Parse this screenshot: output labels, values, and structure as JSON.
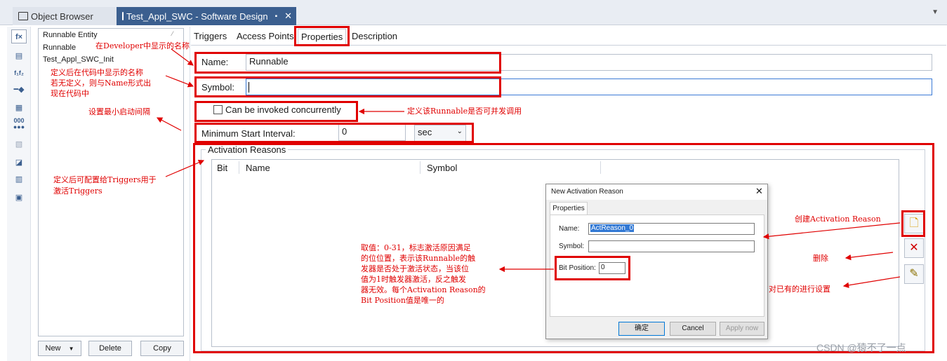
{
  "document_tabs": {
    "object_browser": "Object Browser",
    "software_design": "Test_Appl_SWC - Software Design"
  },
  "runnable_list": {
    "header": "Runnable Entity",
    "items": [
      "Runnable",
      "Test_Appl_SWC_Init"
    ],
    "new_button": "New",
    "delete_button": "Delete",
    "copy_button": "Copy"
  },
  "property_tabs": [
    "Triggers",
    "Access Points",
    "Properties",
    "Description"
  ],
  "properties": {
    "name_label": "Name:",
    "name_value": "Runnable",
    "symbol_label": "Symbol:",
    "symbol_value": "",
    "concurrent_label": "Can be invoked concurrently",
    "concurrent_checked": false,
    "min_interval_label": "Minimum Start Interval:",
    "min_interval_value": "0",
    "min_interval_unit": "sec"
  },
  "activation_reasons": {
    "group_label": "Activation Reasons",
    "columns": [
      "Bit",
      "Name",
      "Symbol"
    ]
  },
  "dialog": {
    "title": "New Activation Reason",
    "tab": "Properties",
    "name_label": "Name:",
    "name_value": "ActReason_0",
    "symbol_label": "Symbol:",
    "symbol_value": "",
    "bit_position_label": "Bit Position:",
    "bit_position_value": "0",
    "ok_button": "确定",
    "cancel_button": "Cancel",
    "apply_button": "Apply now"
  },
  "annotations": {
    "developer_name": "在Developer中显示的名称",
    "symbol_note_1": "定义后在代码中显示的名称",
    "symbol_note_2": "若无定义，则与Name形式出",
    "symbol_note_3": "现在代码中",
    "min_interval_note": "设置最小启动间隔",
    "triggers_note_1": "定义后可配置给Triggers用于",
    "triggers_note_2": "激活Triggers",
    "concurrent_note": "定义该Runnable是否可并发调用",
    "create_note": "创建Activation Reason",
    "delete_note": "删除",
    "edit_note": "对已有的进行设置",
    "bitpos_note_1": "取值：0-31，标志激活原因满足",
    "bitpos_note_2": "的位位置，表示该Runnable的触",
    "bitpos_note_3": "发器是否处于激活状态，当该位",
    "bitpos_note_4": "值为1时触发器激活，反之触发",
    "bitpos_note_5": "器无效。每个Activation Reason的",
    "bitpos_note_6": "Bit Position值是唯一的"
  },
  "watermark": "CSDN @猿不了一点",
  "colors": {
    "annotation_red": "#e00000",
    "active_tab": "#3b5f8f"
  }
}
